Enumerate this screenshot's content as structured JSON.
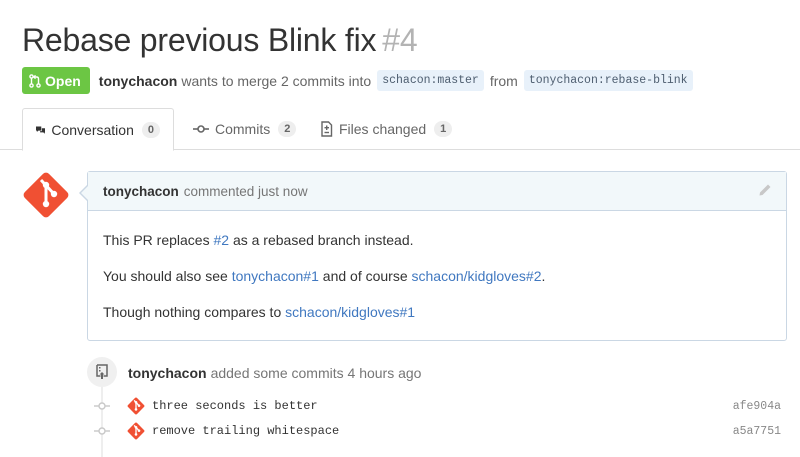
{
  "pr": {
    "title": "Rebase previous Blink fix",
    "number": "#4",
    "state": "Open",
    "author": "tonychacon",
    "merge_text": "wants to merge 2 commits into",
    "base_branch": "schacon:master",
    "from_text": "from",
    "head_branch": "tonychacon:rebase-blink"
  },
  "tabs": [
    {
      "label": "Conversation",
      "count": "0",
      "icon": "comment-discussion-icon"
    },
    {
      "label": "Commits",
      "count": "2",
      "icon": "git-commit-icon"
    },
    {
      "label": "Files changed",
      "count": "1",
      "icon": "diff-icon"
    }
  ],
  "comment": {
    "author": "tonychacon",
    "action": "commented just now",
    "line1": {
      "before": "This PR replaces ",
      "link": "#2",
      "after": " as a rebased branch instead."
    },
    "line2": {
      "before": "You should also see ",
      "link1": "tonychacon#1",
      "mid": " and of course ",
      "link2": "schacon/kidgloves#2",
      "after": "."
    },
    "line3": {
      "before": "Though nothing compares to ",
      "link": "schacon/kidgloves#1"
    }
  },
  "event": {
    "author": "tonychacon",
    "text": "added some commits 4 hours ago"
  },
  "commits": [
    {
      "message": "three seconds is better",
      "sha": "afe904a"
    },
    {
      "message": "remove trailing whitespace",
      "sha": "a5a7751"
    }
  ],
  "colors": {
    "open_green": "#6cc644",
    "link_blue": "#4078c0",
    "avatar_red": "#f05033",
    "comment_border": "#cad7e4",
    "comment_header_bg": "#f2f8fa"
  }
}
